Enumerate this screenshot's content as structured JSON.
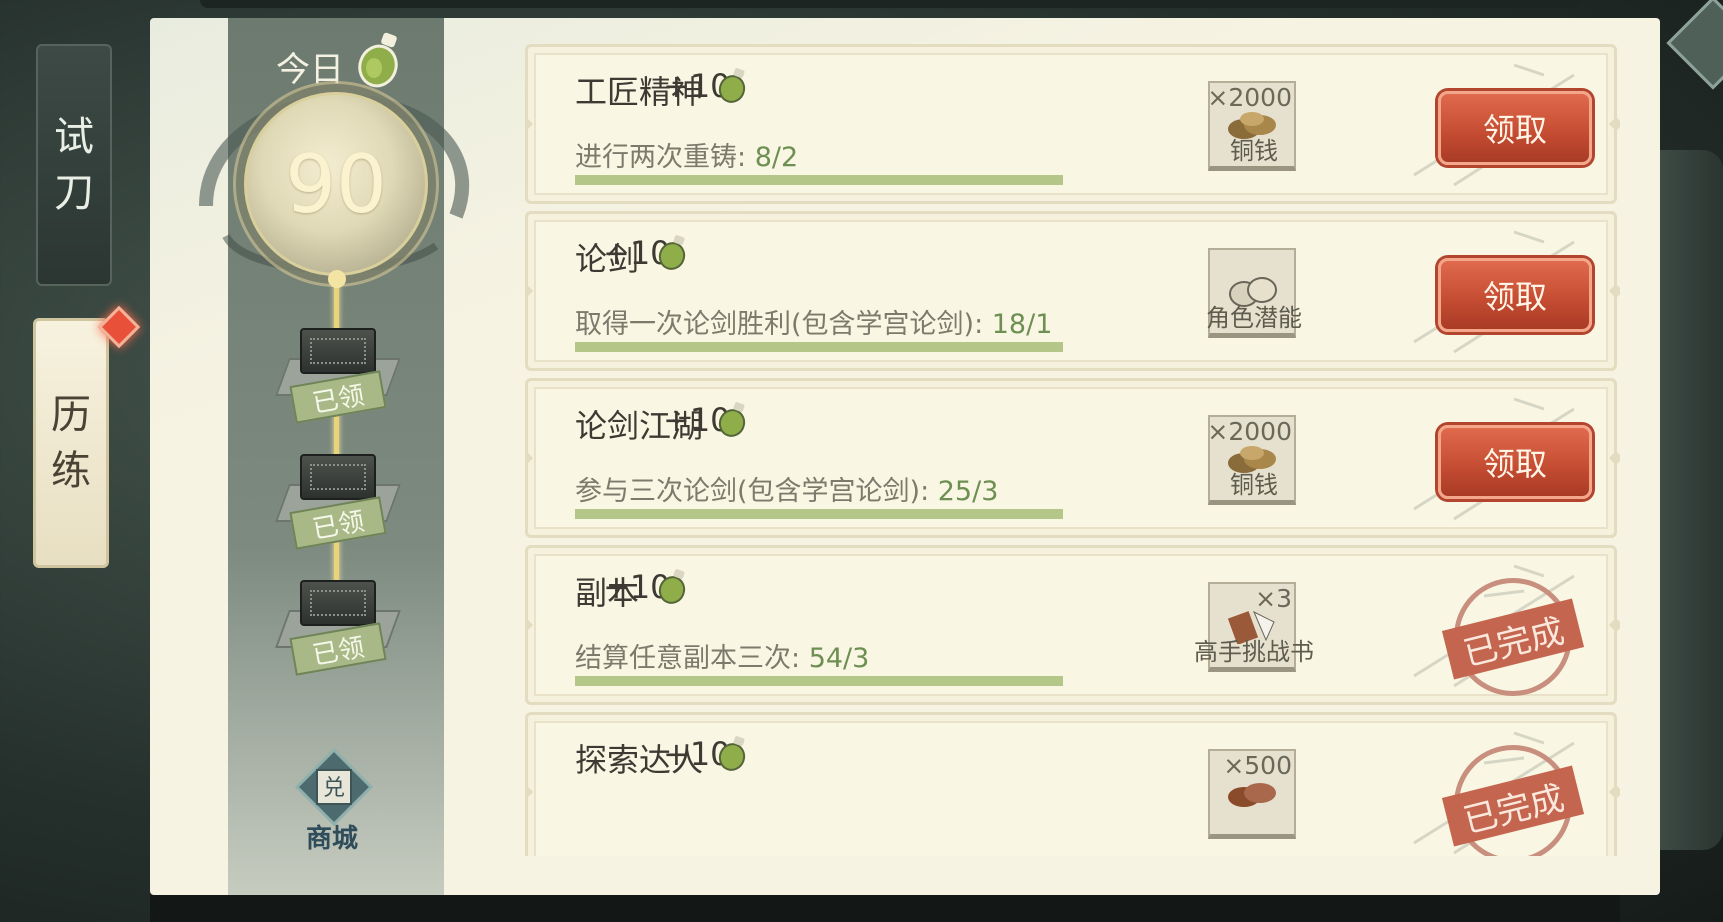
{
  "tabs": [
    {
      "label_line1": "试",
      "label_line2": "刀",
      "active": false
    },
    {
      "label_line1": "历",
      "label_line2": "练",
      "active": true,
      "badge": true
    }
  ],
  "progress": {
    "today_label": "今日",
    "score": "90",
    "chests": [
      {
        "status": "已领"
      },
      {
        "status": "已领"
      },
      {
        "status": "已领"
      }
    ],
    "shop_label": "商城",
    "shop_icon_char": "兑"
  },
  "tasks": [
    {
      "title": "工匠精神",
      "points": "+10",
      "desc": "进行两次重铸: ",
      "progress": "8/2",
      "reward_qty": "×2000",
      "reward_name": "铜钱",
      "reward_icon": "copper-coins",
      "state": "claimable",
      "button": "领取"
    },
    {
      "title": "论剑",
      "points": "+10",
      "desc": "取得一次论剑胜利(包含学宫论剑): ",
      "progress": "18/1",
      "reward_qty": "",
      "reward_name": "角色潜能",
      "reward_icon": "potential-stones",
      "state": "claimable",
      "button": "领取"
    },
    {
      "title": "论剑江湖",
      "points": "+10",
      "desc": "参与三次论剑(包含学宫论剑): ",
      "progress": "25/3",
      "reward_qty": "×2000",
      "reward_name": "铜钱",
      "reward_icon": "copper-coins",
      "state": "claimable",
      "button": "领取"
    },
    {
      "title": "副本",
      "points": "+10",
      "desc": "结算任意副本三次: ",
      "progress": "54/3",
      "reward_qty": "×3",
      "reward_name": "高手挑战书",
      "reward_icon": "challenge-book",
      "state": "done",
      "stamp": "已完成"
    },
    {
      "title": "探索达人",
      "points": "+10",
      "desc": "",
      "progress": "",
      "reward_qty": "×500",
      "reward_name": "",
      "reward_icon": "copper-coins",
      "state": "done",
      "stamp": "已完成"
    }
  ],
  "colors": {
    "claim_button": "#c34b31",
    "progress_bar": "#b4c688",
    "progress_text": "#6d8f52",
    "stamp": "#c4664f"
  }
}
